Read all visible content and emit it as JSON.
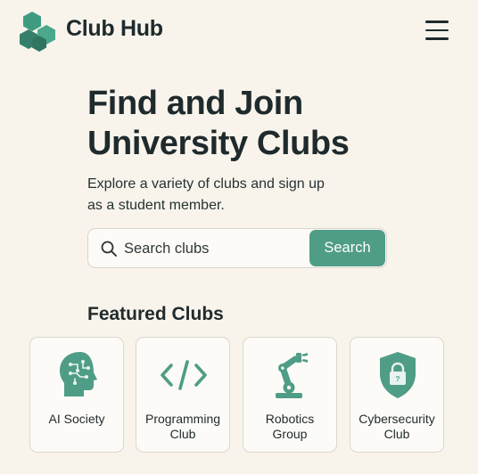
{
  "brand": {
    "name": "Club Hub",
    "logo_icon": "hexagon-cluster-logo"
  },
  "header": {
    "menu_icon": "hamburger-menu-icon"
  },
  "hero": {
    "title_line1": "Find and Join",
    "title_line2": "University Clubs",
    "subtitle_line1": "Explore a variety of clubs and sign up",
    "subtitle_line2": "as a student member."
  },
  "search": {
    "placeholder": "Search clubs",
    "value": "",
    "button_label": "Search"
  },
  "featured": {
    "title": "Featured Clubs",
    "clubs": [
      {
        "line1": "AI Society",
        "line2": "",
        "icon": "ai-brain-icon"
      },
      {
        "line1": "Programming",
        "line2": "Club",
        "icon": "code-icon"
      },
      {
        "line1": "Robotics",
        "line2": "Group",
        "icon": "robot-arm-icon"
      },
      {
        "line1": "Cybersecurity",
        "line2": "Club",
        "icon": "shield-lock-icon"
      }
    ]
  },
  "colors": {
    "background": "#f8f4ec",
    "accent": "#4f9d86",
    "logo_green": "#3f8f78",
    "text": "#1f2a2c"
  }
}
